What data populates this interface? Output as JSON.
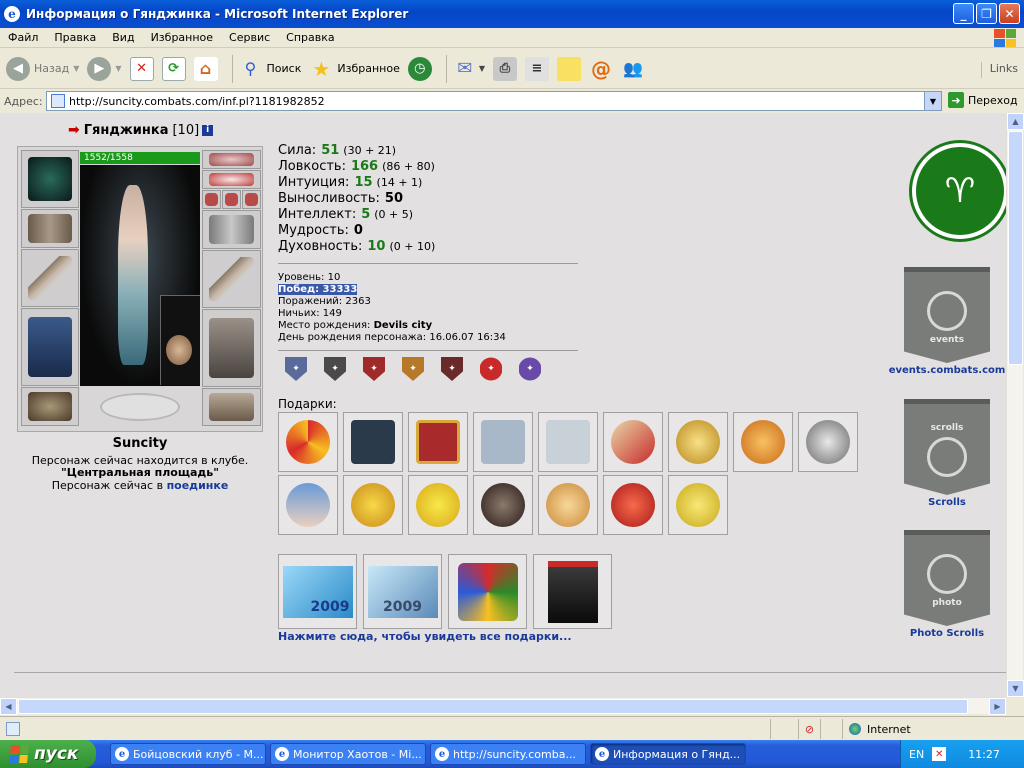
{
  "window": {
    "title": "Информация о Гянджинка - Microsoft Internet Explorer"
  },
  "menu": [
    "Файл",
    "Правка",
    "Вид",
    "Избранное",
    "Сервис",
    "Справка"
  ],
  "toolbar": {
    "back": "Назад",
    "search": "Поиск",
    "favorites": "Избранное",
    "links": "Links"
  },
  "address": {
    "label": "Адрес:",
    "url": "http://suncity.combats.com/inf.pl?1181982852",
    "go": "Переход"
  },
  "character": {
    "name": "Гянджинка",
    "level": "[10]",
    "hp": "1552/1558",
    "city": "Suncity",
    "location_line": "Персонаж сейчас находится в клубе.",
    "location_place": "\"Центральная площадь\"",
    "battle_prefix": "Персонаж сейчас в",
    "battle_link": "поединке"
  },
  "stats": [
    {
      "label": "Сила:",
      "value": "51",
      "sub": "(30 + 21)",
      "green": true
    },
    {
      "label": "Ловкость:",
      "value": "166",
      "sub": "(86 + 80)",
      "green": true
    },
    {
      "label": "Интуиция:",
      "value": "15",
      "sub": "(14 + 1)",
      "green": true
    },
    {
      "label": "Выносливость:",
      "value": "50",
      "sub": "",
      "green": false
    },
    {
      "label": "Интеллект:",
      "value": "5",
      "sub": "(0 + 5)",
      "green": true
    },
    {
      "label": "Мудрость:",
      "value": "0",
      "sub": "",
      "green": false
    },
    {
      "label": "Духовность:",
      "value": "10",
      "sub": "(0 + 10)",
      "green": true
    }
  ],
  "info": {
    "level": "Уровень: 10",
    "wins": "Побед: 33333",
    "losses": "Поражений: 2363",
    "draws": "Ничьих: 149",
    "birthplace_label": "Место рождения:",
    "birthplace": "Devils city",
    "birthday": "День рождения персонажа: 16.06.07 16:34"
  },
  "gifts": {
    "label": "Подарки:",
    "all_link": "Нажмите сюда, чтобы увидеть все подарки..."
  },
  "side": {
    "events": "events.combats.com",
    "scrolls": "Scrolls",
    "photo": "Photo Scrolls",
    "events_banner": "events",
    "scrolls_banner": "scrolls",
    "photo_banner": "photo"
  },
  "cards": {
    "c1": "2009",
    "c2": "2009"
  },
  "status": {
    "zone": "Internet"
  },
  "taskbar": {
    "start": "пуск",
    "tasks": [
      "Бойцовский клуб - M...",
      "Монитор Хаотов - Mi...",
      "http://suncity.comba...",
      "Информация о Гянд..."
    ],
    "lang": "EN",
    "clock": "11:27"
  },
  "colors": {
    "accent_green": "#1a7a1a",
    "link_blue": "#1a3a9a",
    "title_blue": "#0a5fd8"
  }
}
